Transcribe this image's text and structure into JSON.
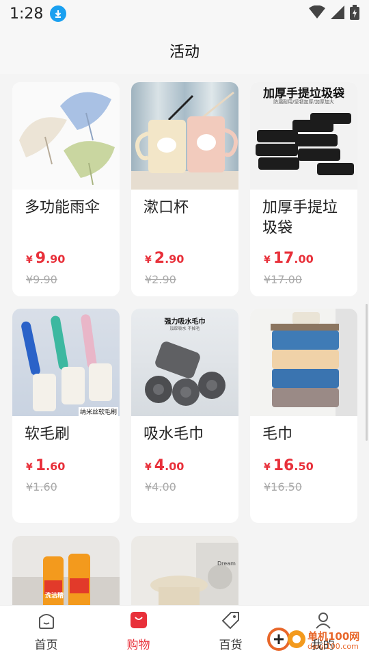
{
  "status": {
    "time": "1:28"
  },
  "header": {
    "title": "活动"
  },
  "products": [
    {
      "name": "多功能雨伞",
      "yen": "¥",
      "int": "9",
      "dec": ".90",
      "orig": "¥9.90"
    },
    {
      "name": "漱口杯",
      "yen": "¥",
      "int": "2",
      "dec": ".90",
      "orig": "¥2.90"
    },
    {
      "name": "加厚手提垃圾袋",
      "yen": "¥",
      "int": "17",
      "dec": ".00",
      "orig": "¥17.00",
      "img_title": "加厚手提垃圾袋",
      "img_sub": "防漏耐用/坚韧加厚/加厚加大"
    },
    {
      "name": "软毛刷",
      "yen": "¥",
      "int": "1",
      "dec": ".60",
      "orig": "¥1.60",
      "img_caption": "纳米丝软毛刷"
    },
    {
      "name": "吸水毛巾",
      "yen": "¥",
      "int": "4",
      "dec": ".00",
      "orig": "¥4.00",
      "img_title": "强力吸水毛巾",
      "img_sub": "加厚吸水 不掉毛"
    },
    {
      "name": "毛巾",
      "yen": "¥",
      "int": "16",
      "dec": ".50",
      "orig": "¥16.50"
    },
    {
      "name": "洗洁精",
      "img_label": "洗洁精"
    },
    {
      "name": "凳子",
      "img_label": "Dream"
    }
  ],
  "nav": [
    {
      "label": "首页",
      "icon": "home-icon"
    },
    {
      "label": "购物",
      "icon": "shopping-bag-icon",
      "active": true
    },
    {
      "label": "百货",
      "icon": "tag-icon"
    },
    {
      "label": "我的",
      "icon": "profile-icon"
    }
  ],
  "watermark": {
    "line1": "单机100网",
    "line2": "danji100.com"
  },
  "colors": {
    "accent": "#e8303a",
    "background": "#f4f4f4"
  }
}
